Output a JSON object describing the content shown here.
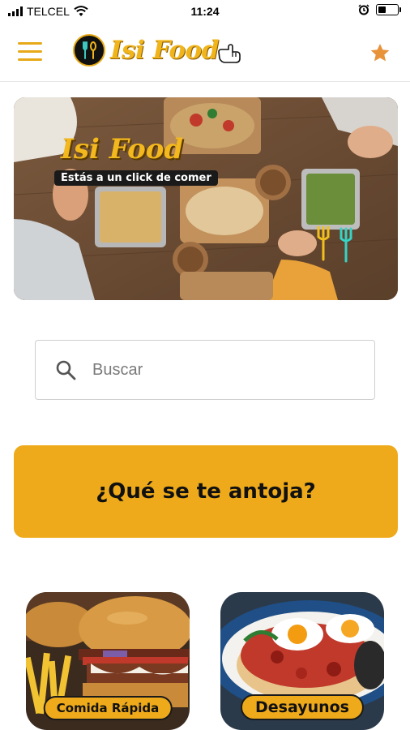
{
  "status_bar": {
    "carrier": "TELCEL",
    "time": "11:24",
    "battery_level": 0.45
  },
  "header": {
    "app_name": "Isi Food",
    "menu_icon": "menu-icon",
    "favorite_icon": "star-icon"
  },
  "banner": {
    "title": "Isi Food",
    "subtitle": "Estás a un click de comer"
  },
  "search": {
    "placeholder": "Buscar",
    "value": ""
  },
  "cta": {
    "label": "¿Qué se te antoja?"
  },
  "categories": [
    {
      "label": "Comida Rápida",
      "icon": "burger-image"
    },
    {
      "label": "Desayunos",
      "icon": "breakfast-image"
    }
  ],
  "colors": {
    "accent": "#eeaa1a",
    "brand_text": "#f1b51c",
    "star": "#e8923a"
  }
}
